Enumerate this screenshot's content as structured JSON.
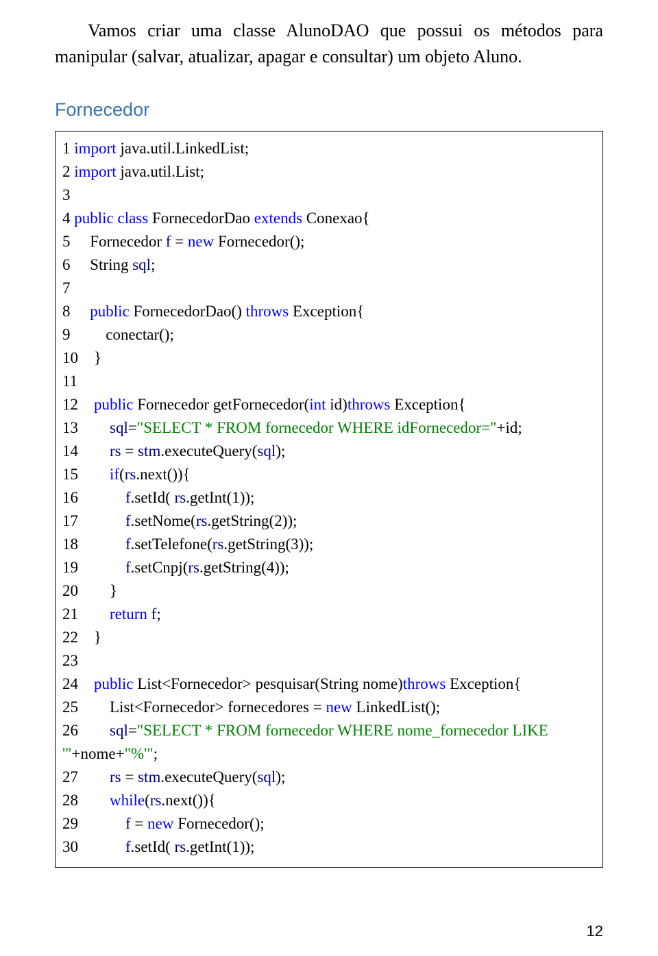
{
  "intro": {
    "paragraph": "Vamos criar uma classe AlunoDAO que possui os métodos para manipular (salvar, atualizar, apagar e consultar) um objeto Aluno."
  },
  "section": {
    "title": "Fornecedor"
  },
  "code": {
    "lines": [
      [
        {
          "t": "1 "
        },
        {
          "t": "import",
          "c": "blue"
        },
        {
          "t": " java.util.LinkedList;"
        }
      ],
      [
        {
          "t": "2 "
        },
        {
          "t": "import",
          "c": "blue"
        },
        {
          "t": " java.util.List;"
        }
      ],
      [
        {
          "t": "3 "
        }
      ],
      [
        {
          "t": "4 "
        },
        {
          "t": "public class ",
          "c": "blue"
        },
        {
          "t": "FornecedorDao "
        },
        {
          "t": "extends",
          "c": "blue"
        },
        {
          "t": " Conexao{"
        }
      ],
      [
        {
          "t": "5     Fornecedor "
        },
        {
          "t": "f",
          "c": "navy"
        },
        {
          "t": " = "
        },
        {
          "t": "new",
          "c": "blue"
        },
        {
          "t": " Fornecedor();"
        }
      ],
      [
        {
          "t": "6     String "
        },
        {
          "t": "sql",
          "c": "navy"
        },
        {
          "t": ";"
        }
      ],
      [
        {
          "t": "7 "
        }
      ],
      [
        {
          "t": "8     "
        },
        {
          "t": "public",
          "c": "blue"
        },
        {
          "t": " FornecedorDao() "
        },
        {
          "t": "throws",
          "c": "blue"
        },
        {
          "t": " Exception{"
        }
      ],
      [
        {
          "t": "9         conectar();"
        }
      ],
      [
        {
          "t": "10    }"
        }
      ],
      [
        {
          "t": "11"
        }
      ],
      [
        {
          "t": "12    "
        },
        {
          "t": "public",
          "c": "blue"
        },
        {
          "t": " Fornecedor getFornecedor("
        },
        {
          "t": "int",
          "c": "blue"
        },
        {
          "t": " id)"
        },
        {
          "t": "throws",
          "c": "blue"
        },
        {
          "t": " Exception{"
        }
      ],
      [
        {
          "t": "13        "
        },
        {
          "t": "sql",
          "c": "navy"
        },
        {
          "t": "="
        },
        {
          "t": "\"SELECT * FROM fornecedor WHERE idFornecedor=\"",
          "c": "green"
        },
        {
          "t": "+id;"
        }
      ],
      [
        {
          "t": "14        "
        },
        {
          "t": "rs",
          "c": "navy"
        },
        {
          "t": " = "
        },
        {
          "t": "stm",
          "c": "navy"
        },
        {
          "t": ".executeQuery("
        },
        {
          "t": "sql",
          "c": "navy"
        },
        {
          "t": ");"
        }
      ],
      [
        {
          "t": "15        "
        },
        {
          "t": "if",
          "c": "blue"
        },
        {
          "t": "("
        },
        {
          "t": "rs",
          "c": "navy"
        },
        {
          "t": ".next()){"
        }
      ],
      [
        {
          "t": "16            "
        },
        {
          "t": "f",
          "c": "navy"
        },
        {
          "t": ".setId( "
        },
        {
          "t": "rs",
          "c": "navy"
        },
        {
          "t": ".getInt(1));"
        }
      ],
      [
        {
          "t": "17            "
        },
        {
          "t": "f",
          "c": "navy"
        },
        {
          "t": ".setNome("
        },
        {
          "t": "rs",
          "c": "navy"
        },
        {
          "t": ".getString(2));"
        }
      ],
      [
        {
          "t": "18            "
        },
        {
          "t": "f",
          "c": "navy"
        },
        {
          "t": ".setTelefone("
        },
        {
          "t": "rs",
          "c": "navy"
        },
        {
          "t": ".getString(3));"
        }
      ],
      [
        {
          "t": "19            "
        },
        {
          "t": "f",
          "c": "navy"
        },
        {
          "t": ".setCnpj("
        },
        {
          "t": "rs",
          "c": "navy"
        },
        {
          "t": ".getString(4));"
        }
      ],
      [
        {
          "t": "20        }"
        }
      ],
      [
        {
          "t": "21        "
        },
        {
          "t": "return ",
          "c": "blue"
        },
        {
          "t": "f",
          "c": "navy"
        },
        {
          "t": ";"
        }
      ],
      [
        {
          "t": "22    }"
        }
      ],
      [
        {
          "t": "23"
        }
      ],
      [
        {
          "t": "24    "
        },
        {
          "t": "public",
          "c": "blue"
        },
        {
          "t": " List<Fornecedor> pesquisar(String nome)"
        },
        {
          "t": "throws",
          "c": "blue"
        },
        {
          "t": " Exception{"
        }
      ],
      [
        {
          "t": "25        List<Fornecedor> fornecedores = "
        },
        {
          "t": "new",
          "c": "blue"
        },
        {
          "t": " LinkedList();"
        }
      ],
      [
        {
          "t": "26        "
        },
        {
          "t": "sql",
          "c": "navy"
        },
        {
          "t": "="
        },
        {
          "t": "\"SELECT * FROM fornecedor WHERE nome_fornecedor LIKE",
          "c": "green"
        }
      ],
      [
        {
          "t": "'\"",
          "c": "green"
        },
        {
          "t": "+nome+"
        },
        {
          "t": "\"%'\"",
          "c": "green"
        },
        {
          "t": ";"
        }
      ],
      [
        {
          "t": "27        "
        },
        {
          "t": "rs",
          "c": "navy"
        },
        {
          "t": " = "
        },
        {
          "t": "stm",
          "c": "navy"
        },
        {
          "t": ".executeQuery("
        },
        {
          "t": "sql",
          "c": "navy"
        },
        {
          "t": ");"
        }
      ],
      [
        {
          "t": "28        "
        },
        {
          "t": "while",
          "c": "blue"
        },
        {
          "t": "("
        },
        {
          "t": "rs",
          "c": "navy"
        },
        {
          "t": ".next()){"
        }
      ],
      [
        {
          "t": "29            "
        },
        {
          "t": "f",
          "c": "navy"
        },
        {
          "t": " = "
        },
        {
          "t": "new",
          "c": "blue"
        },
        {
          "t": " Fornecedor();"
        }
      ],
      [
        {
          "t": "30            "
        },
        {
          "t": "f",
          "c": "navy"
        },
        {
          "t": ".setId( "
        },
        {
          "t": "rs",
          "c": "navy"
        },
        {
          "t": ".getInt(1));"
        }
      ]
    ]
  },
  "page_number": "12"
}
